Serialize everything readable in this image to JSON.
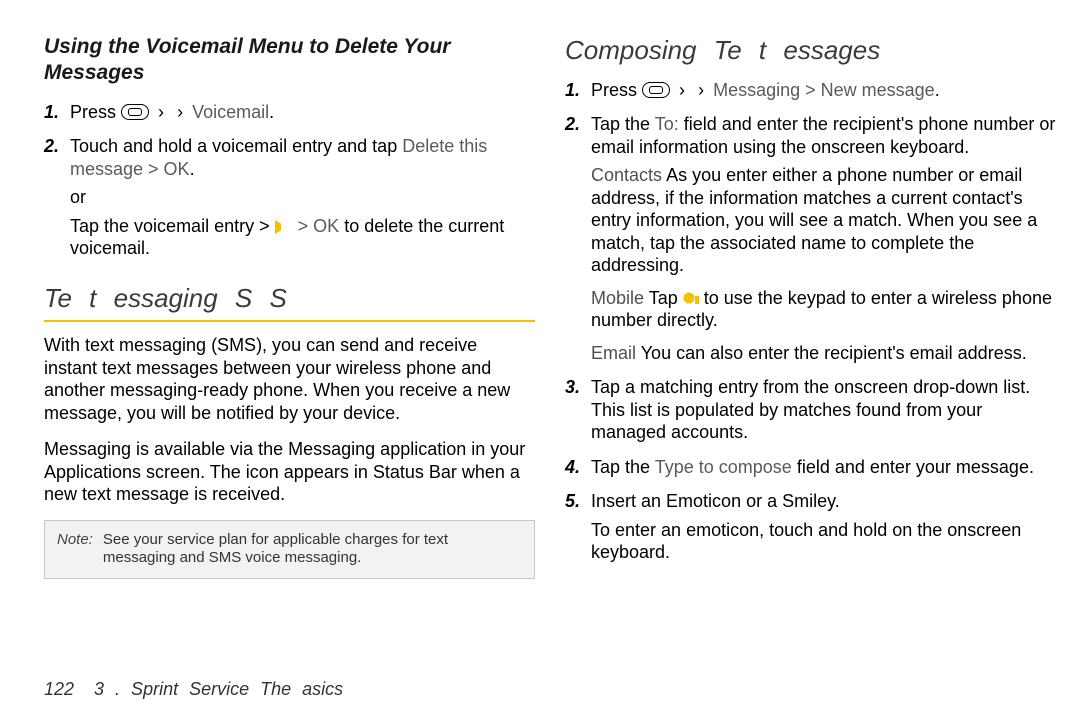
{
  "left": {
    "subhead": "Using the Voicemail Menu to Delete Your Messages",
    "steps": [
      {
        "num": "1.",
        "prefix": "Press",
        "path": "Voicemail",
        "suffix": "."
      },
      {
        "num": "2.",
        "prefix": "Touch and hold a voicemail entry and tap",
        "path": "Delete this message > OK",
        "suffix": ".",
        "or": "or",
        "alt_prefix": "Tap the voicemail entry >",
        "alt_path": "> OK",
        "alt_suffix": " to delete the current voicemail."
      }
    ],
    "section_title": "Te   t    essaging   S   S",
    "para1": "With text messaging (SMS), you can send and receive instant text messages between your wireless phone and another messaging-ready phone. When you receive a new message, you will be notified by your device.",
    "para2": "Messaging is available via the Messaging application in your Applications screen. The icon     appears in Status Bar when a new text message is received.",
    "note_label": "Note:",
    "note_text": "See your service plan for applicable charges for text messaging and SMS voice messaging."
  },
  "right": {
    "section_title": "Composing Te   t    essages",
    "steps": [
      {
        "num": "1.",
        "prefix": "Press",
        "path": "Messaging > New message",
        "suffix": "."
      },
      {
        "num": "2.",
        "text_a": "Tap the ",
        "field": "To:",
        "text_b": " field and enter the recipient's phone number or email information using the onscreen keyboard.",
        "tips": [
          {
            "label": "Contacts",
            "text": "As you enter either a phone number or email address, if the information matches a current contact's entry information, you will see a match. When you see a match, tap the associated name to complete the addressing."
          },
          {
            "label": "Mobile",
            "text_a": "Tap ",
            "text_b": " to use the keypad to enter a wireless phone number directly."
          },
          {
            "label": "Email",
            "text": "You can also enter the recipient's email address."
          }
        ]
      },
      {
        "num": "3.",
        "text": "Tap a matching entry from the onscreen drop-down list. This list is populated by matches found from your managed accounts."
      },
      {
        "num": "4.",
        "text_a": "Tap the ",
        "field": "Type to compose",
        "text_b": " field and enter your message."
      },
      {
        "num": "5.",
        "text": "Insert an Emoticon or a Smiley.",
        "sub": "To enter an emoticon, touch and hold      on the onscreen keyboard."
      }
    ]
  },
  "footer": {
    "page": "122",
    "section": "3  . Sprint Service    The   asics"
  }
}
